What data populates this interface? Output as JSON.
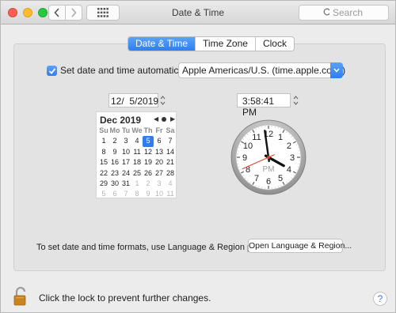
{
  "window": {
    "title": "Date & Time"
  },
  "toolbar": {
    "search_placeholder": "Search"
  },
  "tabs": [
    {
      "label": "Date & Time",
      "active": true
    },
    {
      "label": "Time Zone",
      "active": false
    },
    {
      "label": "Clock",
      "active": false
    }
  ],
  "auto_time": {
    "label": "Set date and time automatically:",
    "checked": true,
    "server": "Apple Americas/U.S. (time.apple.com.)"
  },
  "date_field": {
    "value": "12/  5/2019"
  },
  "time_field": {
    "value": "3:58:41 PM"
  },
  "calendar": {
    "title": "Dec 2019",
    "weekdays": [
      "Su",
      "Mo",
      "Tu",
      "We",
      "Th",
      "Fr",
      "Sa"
    ],
    "weeks": [
      [
        "1",
        "2",
        "3",
        "4",
        "5",
        "6",
        "7"
      ],
      [
        "8",
        "9",
        "10",
        "11",
        "12",
        "13",
        "14"
      ],
      [
        "15",
        "16",
        "17",
        "18",
        "19",
        "20",
        "21"
      ],
      [
        "22",
        "23",
        "24",
        "25",
        "26",
        "27",
        "28"
      ],
      [
        "29",
        "30",
        "31",
        "1",
        "2",
        "3",
        "4"
      ],
      [
        "5",
        "6",
        "7",
        "8",
        "9",
        "10",
        "11"
      ]
    ],
    "selected_day": "5"
  },
  "clock": {
    "numbers": [
      "12",
      "1",
      "2",
      "3",
      "4",
      "5",
      "6",
      "7",
      "8",
      "9",
      "10",
      "11"
    ],
    "period": "PM",
    "hour": 3,
    "minute": 58,
    "second": 41
  },
  "footer": {
    "formats_text": "To set date and time formats, use Language & Region preferences.",
    "open_button": "Open Language & Region...",
    "lock_text": "Click the lock to prevent further changes.",
    "help_label": "?"
  },
  "colors": {
    "accent": "#2f7ef0",
    "second_hand": "#d9432b"
  }
}
